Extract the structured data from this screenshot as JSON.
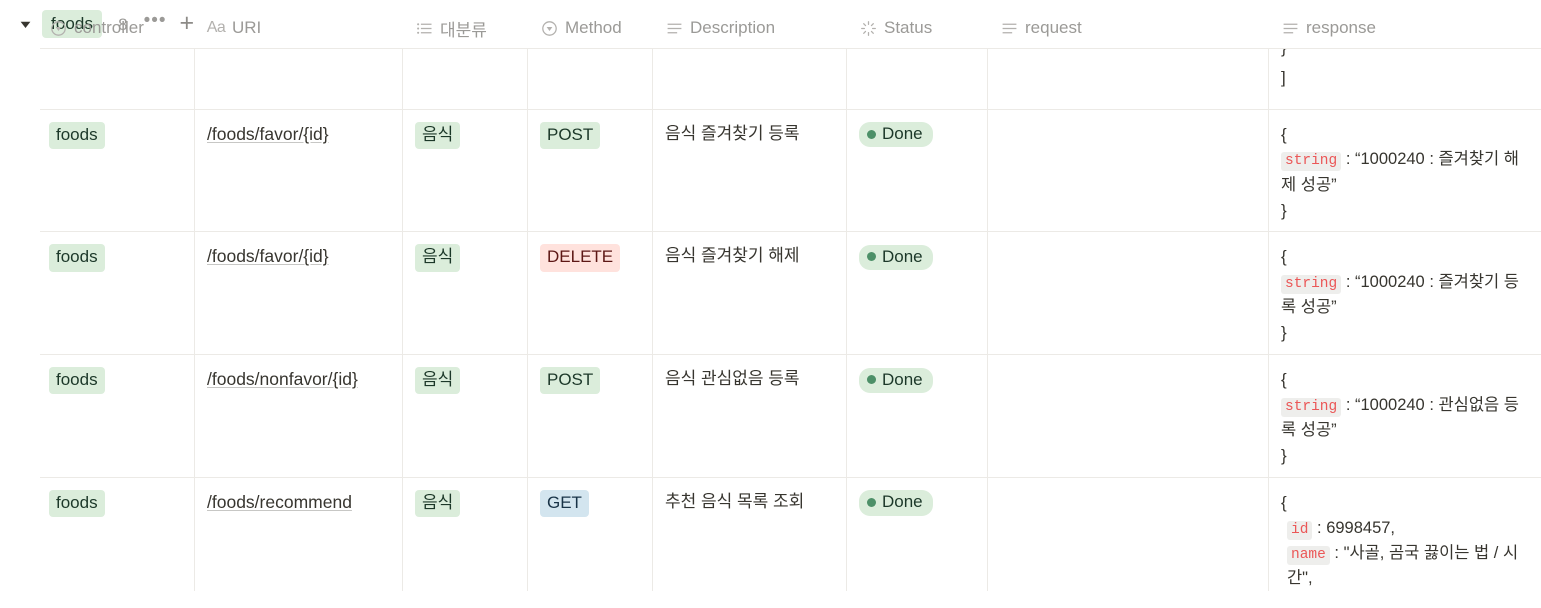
{
  "group": {
    "caret_icon": "triangle-down-icon",
    "tag_label": "foods",
    "count": "8",
    "more_label": "•••",
    "add_label": "+"
  },
  "table": {
    "columns": [
      {
        "key": "controller",
        "label": "controller",
        "icon": "select-property-icon"
      },
      {
        "key": "uri",
        "label": "URI",
        "icon": "title-aa-icon"
      },
      {
        "key": "category",
        "label": "대분류",
        "icon": "multi-select-icon"
      },
      {
        "key": "method",
        "label": "Method",
        "icon": "select-property-icon"
      },
      {
        "key": "description",
        "label": "Description",
        "icon": "text-property-icon"
      },
      {
        "key": "status",
        "label": "Status",
        "icon": "status-property-icon"
      },
      {
        "key": "request",
        "label": "request",
        "icon": "text-property-icon"
      },
      {
        "key": "response",
        "label": "response",
        "icon": "text-property-icon"
      }
    ],
    "partial_row": {
      "response_line_1": "}",
      "response_line_2": "]"
    },
    "rows": [
      {
        "controller": "foods",
        "uri": "/foods/favor/{id}",
        "category": "음식",
        "method": "POST",
        "method_color": "green",
        "description": "음식 즐겨찾기 등록",
        "status": "Done",
        "request": "",
        "response": {
          "open": "{",
          "key": "string",
          "sep": ":",
          "value": "“1000240 : 즐겨찾기 해제 성공”",
          "close": "}"
        }
      },
      {
        "controller": "foods",
        "uri": "/foods/favor/{id}",
        "category": "음식",
        "method": "DELETE",
        "method_color": "red",
        "description": "음식 즐겨찾기 해제",
        "status": "Done",
        "request": "",
        "response": {
          "open": "{",
          "key": "string",
          "sep": ":",
          "value": "“1000240 : 즐겨찾기 등록 성공”",
          "close": "}"
        }
      },
      {
        "controller": "foods",
        "uri": "/foods/nonfavor/{id}",
        "category": "음식",
        "method": "POST",
        "method_color": "green",
        "description": "음식 관심없음 등록",
        "status": "Done",
        "request": "",
        "response": {
          "open": "{",
          "key": "string",
          "sep": ":",
          "value": "“1000240 : 관심없음 등록 성공”",
          "close": "}"
        }
      },
      {
        "controller": "foods",
        "uri": "/foods/recommend",
        "category": "음식",
        "method": "GET",
        "method_color": "blue",
        "description": "추천 음식 목록 조회",
        "status": "Done",
        "request": "",
        "response": {
          "open": "{",
          "key": "id",
          "sep": ":",
          "value": "6998457,",
          "key2": "name",
          "sep2": ":",
          "value2": "\"사골, 곰국 끓이는 법 / 시간\","
        }
      }
    ]
  },
  "colors": {
    "tag_green_bg": "#dbeddb",
    "tag_green_fg": "#1c3829",
    "tag_red_bg": "#ffe2dd",
    "tag_red_fg": "#5d1715",
    "tag_blue_bg": "#d3e5ef",
    "tag_blue_fg": "#183347",
    "status_dot": "#4d9068",
    "code_fg": "#eb5757",
    "code_bg": "#eeeeec",
    "grid_line": "#eceae6",
    "header_fg": "#9b9a97"
  }
}
